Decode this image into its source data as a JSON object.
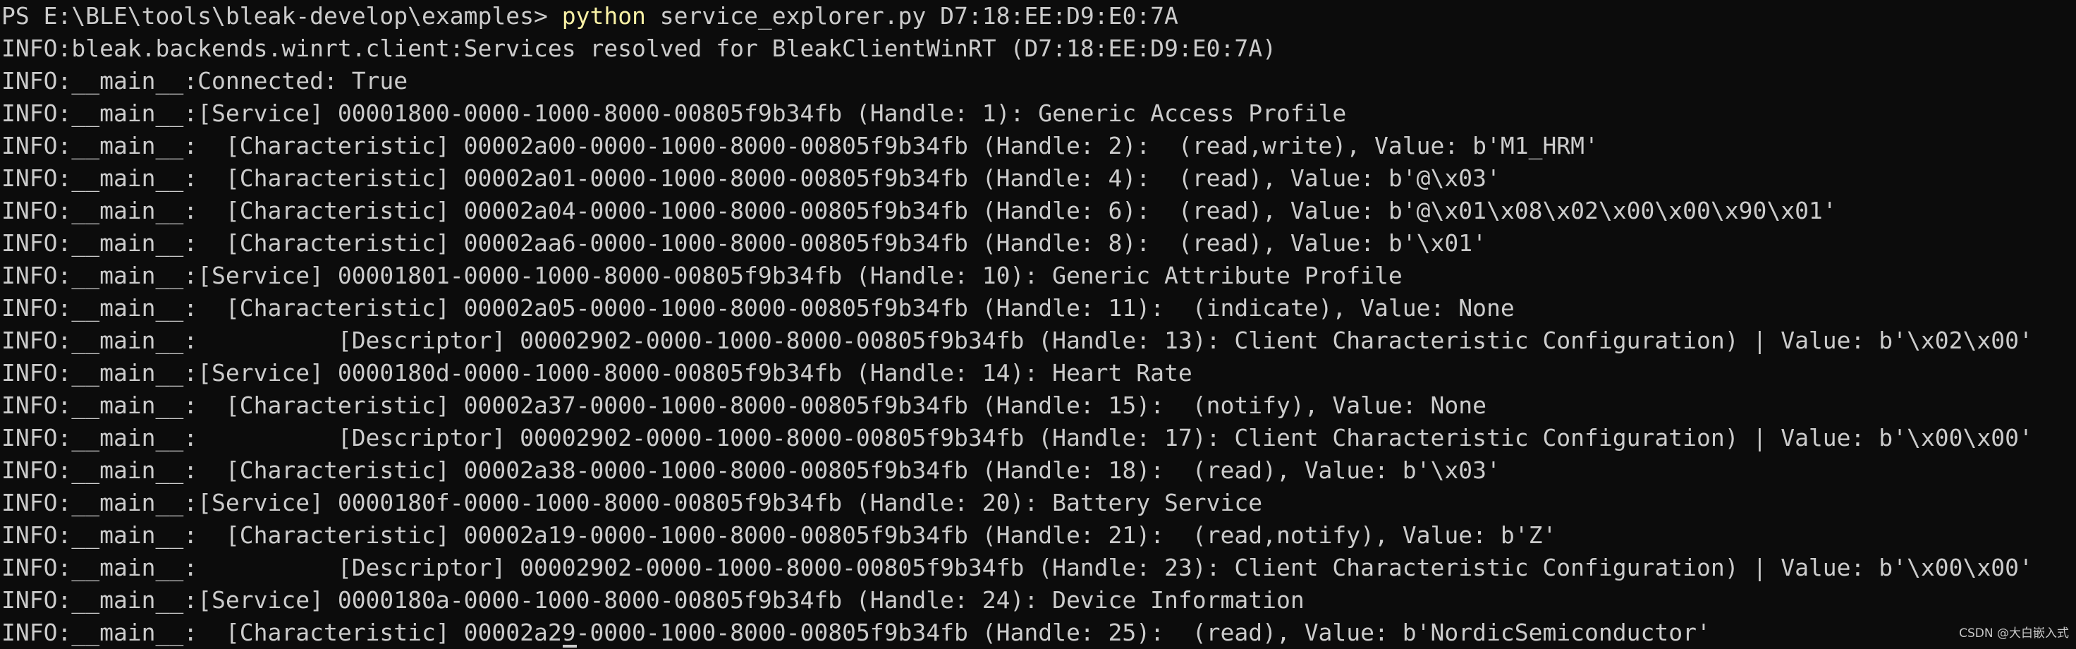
{
  "terminal": {
    "prompt": "PS E:\\BLE\\tools\\bleak-develop\\examples> ",
    "command": "python",
    "args": " service_explorer.py D7:18:EE:D9:E0:7A",
    "command_color": "#f9f1a5",
    "text_color": "#cccccc",
    "background_color": "#0c0c0c",
    "output_lines": [
      "INFO:bleak.backends.winrt.client:Services resolved for BleakClientWinRT (D7:18:EE:D9:E0:7A)",
      "INFO:__main__:Connected: True",
      "INFO:__main__:[Service] 00001800-0000-1000-8000-00805f9b34fb (Handle: 1): Generic Access Profile",
      "INFO:__main__:  [Characteristic] 00002a00-0000-1000-8000-00805f9b34fb (Handle: 2):  (read,write), Value: b'M1_HRM'",
      "INFO:__main__:  [Characteristic] 00002a01-0000-1000-8000-00805f9b34fb (Handle: 4):  (read), Value: b'@\\x03'",
      "INFO:__main__:  [Characteristic] 00002a04-0000-1000-8000-00805f9b34fb (Handle: 6):  (read), Value: b'@\\x01\\x08\\x02\\x00\\x00\\x90\\x01'",
      "INFO:__main__:  [Characteristic] 00002aa6-0000-1000-8000-00805f9b34fb (Handle: 8):  (read), Value: b'\\x01'",
      "INFO:__main__:[Service] 00001801-0000-1000-8000-00805f9b34fb (Handle: 10): Generic Attribute Profile",
      "INFO:__main__:  [Characteristic] 00002a05-0000-1000-8000-00805f9b34fb (Handle: 11):  (indicate), Value: None",
      "INFO:__main__:          [Descriptor] 00002902-0000-1000-8000-00805f9b34fb (Handle: 13): Client Characteristic Configuration) | Value: b'\\x02\\x00'",
      "INFO:__main__:[Service] 0000180d-0000-1000-8000-00805f9b34fb (Handle: 14): Heart Rate",
      "INFO:__main__:  [Characteristic] 00002a37-0000-1000-8000-00805f9b34fb (Handle: 15):  (notify), Value: None",
      "INFO:__main__:          [Descriptor] 00002902-0000-1000-8000-00805f9b34fb (Handle: 17): Client Characteristic Configuration) | Value: b'\\x00\\x00'",
      "INFO:__main__:  [Characteristic] 00002a38-0000-1000-8000-00805f9b34fb (Handle: 18):  (read), Value: b'\\x03'",
      "INFO:__main__:[Service] 0000180f-0000-1000-8000-00805f9b34fb (Handle: 20): Battery Service",
      "INFO:__main__:  [Characteristic] 00002a19-0000-1000-8000-00805f9b34fb (Handle: 21):  (read,notify), Value: b'Z'",
      "INFO:__main__:          [Descriptor] 00002902-0000-1000-8000-00805f9b34fb (Handle: 23): Client Characteristic Configuration) | Value: b'\\x00\\x00'",
      "INFO:__main__:[Service] 0000180a-0000-1000-8000-00805f9b34fb (Handle: 24): Device Information",
      "INFO:__main__:  [Characteristic] 00002a29-0000-1000-8000-00805f9b34fb (Handle: 25):  (read), Value: b'NordicSemiconductor'"
    ]
  },
  "watermark": "CSDN @大白嵌入式"
}
